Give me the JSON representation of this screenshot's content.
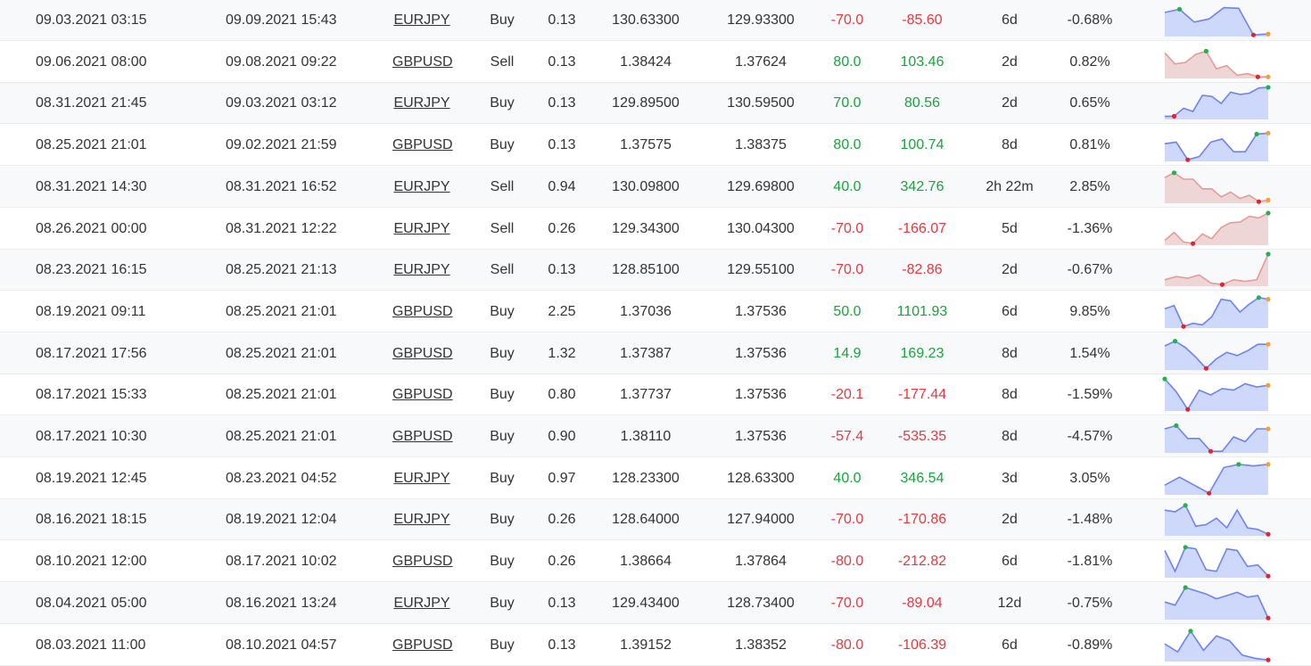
{
  "colors": {
    "positive": "#1aa33c",
    "negative": "#e8383d",
    "buy_line": "#6f83ef",
    "buy_fill": "#cdd8fb",
    "sell_line": "#e59a9a",
    "sell_fill": "#efd6d6",
    "marker_max": "#22b14c",
    "marker_min": "#e8212a",
    "marker_end": "#f5a033"
  },
  "trades": [
    {
      "open": "09.03.2021 03:15",
      "close": "09.09.2021 15:43",
      "symbol": "EURJPY",
      "type": "Buy",
      "lots": "0.13",
      "open_price": "130.63300",
      "close_price": "129.93300",
      "pips": "-70.0",
      "profit": "-85.60",
      "duration": "6d",
      "gain": "-0.68%",
      "sign": "neg",
      "spark": [
        0.75,
        0.85,
        0.45,
        0.55,
        0.9,
        0.88,
        0.05,
        0.08
      ],
      "spark_max": 1,
      "spark_min": 6
    },
    {
      "open": "09.06.2021 08:00",
      "close": "09.08.2021 09:22",
      "symbol": "GBPUSD",
      "type": "Sell",
      "lots": "0.13",
      "open_price": "1.38424",
      "close_price": "1.37624",
      "pips": "80.0",
      "profit": "103.46",
      "duration": "2d",
      "gain": "0.82%",
      "sign": "pos",
      "spark": [
        0.8,
        0.45,
        0.5,
        0.75,
        0.85,
        0.3,
        0.4,
        0.1,
        0.15,
        0.05,
        0.05
      ],
      "spark_max": 4,
      "spark_min": 9
    },
    {
      "open": "08.31.2021 21:45",
      "close": "09.03.2021 03:12",
      "symbol": "EURJPY",
      "type": "Buy",
      "lots": "0.13",
      "open_price": "129.89500",
      "close_price": "130.59500",
      "pips": "70.0",
      "profit": "80.56",
      "duration": "2d",
      "gain": "0.65%",
      "sign": "pos",
      "spark": [
        0.1,
        0.1,
        0.35,
        0.25,
        0.75,
        0.72,
        0.5,
        0.85,
        0.78,
        0.82,
        0.98,
        1.0
      ],
      "spark_max": 11,
      "spark_min": 1
    },
    {
      "open": "08.25.2021 21:01",
      "close": "09.02.2021 21:59",
      "symbol": "GBPUSD",
      "type": "Buy",
      "lots": "0.13",
      "open_price": "1.37575",
      "close_price": "1.38375",
      "pips": "80.0",
      "profit": "100.74",
      "duration": "8d",
      "gain": "0.81%",
      "sign": "pos",
      "spark": [
        0.55,
        0.6,
        0.05,
        0.15,
        0.6,
        0.7,
        0.3,
        0.3,
        0.85,
        0.88
      ],
      "spark_max": 8,
      "spark_min": 2
    },
    {
      "open": "08.31.2021 14:30",
      "close": "08.31.2021 16:52",
      "symbol": "EURJPY",
      "type": "Sell",
      "lots": "0.94",
      "open_price": "130.09800",
      "close_price": "129.69800",
      "pips": "40.0",
      "profit": "342.76",
      "duration": "2h 22m",
      "gain": "2.85%",
      "sign": "pos",
      "spark": [
        0.8,
        0.95,
        0.75,
        0.75,
        0.45,
        0.45,
        0.2,
        0.35,
        0.15,
        0.25,
        0.05,
        0.1
      ],
      "spark_max": 1,
      "spark_min": 10
    },
    {
      "open": "08.26.2021 00:00",
      "close": "08.31.2021 12:22",
      "symbol": "EURJPY",
      "type": "Sell",
      "lots": "0.26",
      "open_price": "129.34300",
      "close_price": "130.04300",
      "pips": "-70.0",
      "profit": "-166.07",
      "duration": "5d",
      "gain": "-1.36%",
      "sign": "neg",
      "spark": [
        0.15,
        0.4,
        0.1,
        0.05,
        0.35,
        0.2,
        0.55,
        0.7,
        0.72,
        0.9,
        0.85,
        1.0
      ],
      "spark_max": 11,
      "spark_min": 3
    },
    {
      "open": "08.23.2021 16:15",
      "close": "08.25.2021 21:13",
      "symbol": "EURJPY",
      "type": "Sell",
      "lots": "0.13",
      "open_price": "128.85100",
      "close_price": "129.55100",
      "pips": "-70.0",
      "profit": "-82.86",
      "duration": "2d",
      "gain": "-0.67%",
      "sign": "neg",
      "spark": [
        0.2,
        0.3,
        0.25,
        0.35,
        0.1,
        0.05,
        0.2,
        0.15,
        0.2,
        1.0
      ],
      "spark_max": 9,
      "spark_min": 5
    },
    {
      "open": "08.19.2021 09:11",
      "close": "08.25.2021 21:01",
      "symbol": "GBPUSD",
      "type": "Buy",
      "lots": "2.25",
      "open_price": "1.37036",
      "close_price": "1.37536",
      "pips": "50.0",
      "profit": "1101.93",
      "duration": "6d",
      "gain": "9.85%",
      "sign": "pos",
      "spark": [
        0.6,
        0.7,
        0.05,
        0.15,
        0.1,
        0.35,
        0.9,
        0.85,
        0.5,
        0.75,
        0.95,
        0.9
      ],
      "spark_max": 10,
      "spark_min": 2
    },
    {
      "open": "08.17.2021 17:56",
      "close": "08.25.2021 21:01",
      "symbol": "GBPUSD",
      "type": "Buy",
      "lots": "1.32",
      "open_price": "1.37387",
      "close_price": "1.37536",
      "pips": "14.9",
      "profit": "169.23",
      "duration": "8d",
      "gain": "1.54%",
      "sign": "pos",
      "spark": [
        0.75,
        0.9,
        0.7,
        0.4,
        0.05,
        0.35,
        0.55,
        0.45,
        0.6,
        0.8,
        0.8
      ],
      "spark_max": 1,
      "spark_min": 4
    },
    {
      "open": "08.17.2021 15:33",
      "close": "08.25.2021 21:01",
      "symbol": "GBPUSD",
      "type": "Buy",
      "lots": "0.80",
      "open_price": "1.37737",
      "close_price": "1.37536",
      "pips": "-20.1",
      "profit": "-177.44",
      "duration": "8d",
      "gain": "-1.59%",
      "sign": "neg",
      "spark": [
        1.0,
        0.6,
        0.05,
        0.65,
        0.5,
        0.7,
        0.65,
        0.85,
        0.75,
        0.8
      ],
      "spark_max": 0,
      "spark_min": 2
    },
    {
      "open": "08.17.2021 10:30",
      "close": "08.25.2021 21:01",
      "symbol": "GBPUSD",
      "type": "Buy",
      "lots": "0.90",
      "open_price": "1.38110",
      "close_price": "1.37536",
      "pips": "-57.4",
      "profit": "-535.35",
      "duration": "8d",
      "gain": "-4.57%",
      "sign": "neg",
      "spark": [
        0.75,
        0.85,
        0.45,
        0.45,
        0.05,
        0.05,
        0.5,
        0.35,
        0.75,
        0.75
      ],
      "spark_max": 1,
      "spark_min": 4
    },
    {
      "open": "08.19.2021 12:45",
      "close": "08.23.2021 04:52",
      "symbol": "EURJPY",
      "type": "Buy",
      "lots": "0.97",
      "open_price": "128.23300",
      "close_price": "128.63300",
      "pips": "40.0",
      "profit": "346.54",
      "duration": "3d",
      "gain": "3.05%",
      "sign": "pos",
      "spark": [
        0.3,
        0.55,
        0.3,
        0.05,
        0.85,
        0.95,
        0.9,
        0.95
      ],
      "spark_max": 5,
      "spark_min": 3
    },
    {
      "open": "08.16.2021 18:15",
      "close": "08.19.2021 12:04",
      "symbol": "EURJPY",
      "type": "Buy",
      "lots": "0.26",
      "open_price": "128.64000",
      "close_price": "127.94000",
      "pips": "-70.0",
      "profit": "-170.86",
      "duration": "2d",
      "gain": "-1.48%",
      "sign": "neg",
      "spark": [
        0.8,
        0.75,
        0.95,
        0.3,
        0.35,
        0.55,
        0.25,
        0.8,
        0.25,
        0.2,
        0.05
      ],
      "spark_max": 2,
      "spark_min": 10
    },
    {
      "open": "08.10.2021 12:00",
      "close": "08.17.2021 10:02",
      "symbol": "GBPUSD",
      "type": "Buy",
      "lots": "0.26",
      "open_price": "1.38664",
      "close_price": "1.37864",
      "pips": "-80.0",
      "profit": "-212.82",
      "duration": "6d",
      "gain": "-1.81%",
      "sign": "neg",
      "spark": [
        0.85,
        0.2,
        0.95,
        0.9,
        0.25,
        0.2,
        0.9,
        0.85,
        0.35,
        0.4,
        0.05
      ],
      "spark_max": 2,
      "spark_min": 10
    },
    {
      "open": "08.04.2021 05:00",
      "close": "08.16.2021 13:24",
      "symbol": "EURJPY",
      "type": "Buy",
      "lots": "0.13",
      "open_price": "129.43400",
      "close_price": "128.73400",
      "pips": "-70.0",
      "profit": "-89.04",
      "duration": "12d",
      "gain": "-0.75%",
      "sign": "neg",
      "spark": [
        0.55,
        0.45,
        1.0,
        0.9,
        0.8,
        0.65,
        0.75,
        0.85,
        0.7,
        0.75,
        0.05
      ],
      "spark_max": 2,
      "spark_min": 10
    },
    {
      "open": "08.03.2021 11:00",
      "close": "08.10.2021 04:57",
      "symbol": "GBPUSD",
      "type": "Buy",
      "lots": "0.13",
      "open_price": "1.39152",
      "close_price": "1.38352",
      "pips": "-80.0",
      "profit": "-106.39",
      "duration": "6d",
      "gain": "-0.89%",
      "sign": "neg",
      "spark": [
        0.55,
        0.3,
        0.95,
        0.35,
        0.8,
        0.65,
        0.2,
        0.1,
        0.05
      ],
      "spark_max": 2,
      "spark_min": 8
    }
  ]
}
